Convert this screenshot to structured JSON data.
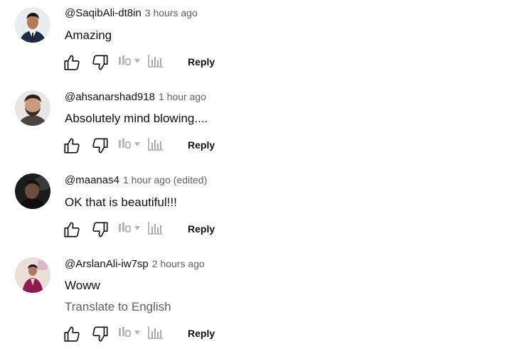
{
  "comments": [
    {
      "author": "@SaqibAli-dt8in",
      "time": "3 hours ago",
      "text": "Amazing",
      "translate": ""
    },
    {
      "author": "@ahsanarshad918",
      "time": "1 hour ago",
      "text": "Absolutely mind blowing....",
      "translate": ""
    },
    {
      "author": "@maanas4",
      "time": "1 hour ago (edited)",
      "text": "OK that is beautiful!!!",
      "translate": ""
    },
    {
      "author": "@ArslanAli-iw7sp",
      "time": "2 hours ago",
      "text": "Woww",
      "translate": "Translate to English"
    }
  ],
  "actions": {
    "reply_label": "Reply"
  },
  "icons": [
    "thumbs-up-icon",
    "thumbs-down-icon",
    "vote-dropdown-icon",
    "stats-bars-icon"
  ],
  "colors": {
    "text": "#0f0f0f",
    "meta": "#606060",
    "icon": "#0f0f0f",
    "faded_icon": "#b5b5b5"
  }
}
